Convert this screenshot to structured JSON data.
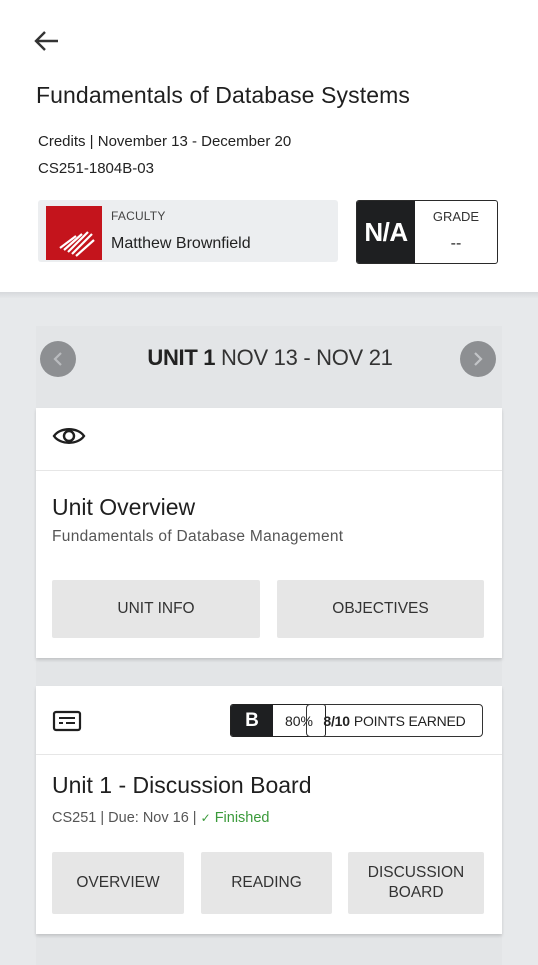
{
  "header": {
    "back_icon": "arrow-left-icon",
    "course_title": "Fundamentals of Database Systems",
    "credits_dates": "Credits | November 13 - December 20",
    "course_code": "CS251-1804B-03"
  },
  "faculty": {
    "label": "FACULTY",
    "name": "Matthew Brownfield",
    "logo_color": "#c4141c"
  },
  "grade": {
    "value": "N/A",
    "label": "GRADE",
    "display": "--"
  },
  "unit_nav": {
    "unit": "UNIT 1",
    "dates": "NOV 13 - NOV 21",
    "prev_icon": "chevron-left-icon",
    "next_icon": "chevron-right-icon"
  },
  "overview_card": {
    "icon": "eye-icon",
    "title": "Unit Overview",
    "subtitle": "Fundamentals of Database Management",
    "buttons": [
      "UNIT INFO",
      "OBJECTIVES"
    ]
  },
  "discussion_card": {
    "icon": "document-icon",
    "score_letter": "B",
    "score_percent": "80%",
    "points_value": "8/10",
    "points_label": "POINTS EARNED",
    "title": "Unit 1 - Discussion Board",
    "meta": "CS251 | Due: Nov 16 | ",
    "status": "Finished",
    "status_color": "#3a9a3a",
    "buttons": [
      "OVERVIEW",
      "READING",
      "DISCUSSION BOARD"
    ]
  }
}
